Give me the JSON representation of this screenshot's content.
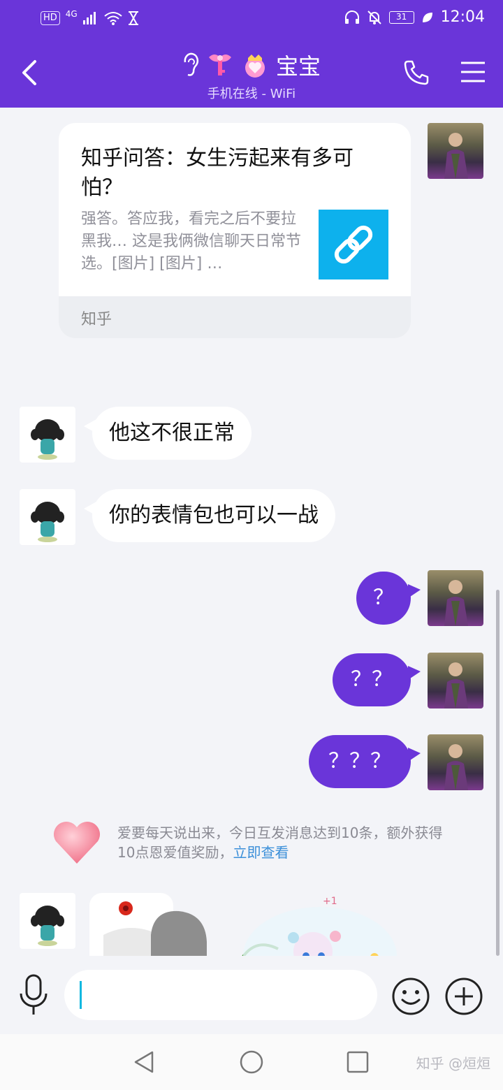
{
  "status_bar": {
    "left_icons": [
      "hd-icon",
      "4g-signal-icon",
      "wifi-icon",
      "hourglass-icon"
    ],
    "hd_label": "HD",
    "net_label": "4G",
    "battery": "31",
    "time": "12:04"
  },
  "header": {
    "title": "宝宝",
    "subtitle": "手机在线 - WiFi"
  },
  "link_card": {
    "title": "知乎问答：女生污起来有多可怕？",
    "description": "强答。答应我，看完之后不要拉黑我… 这是我俩微信聊天日常节选。[图片] [图片] …",
    "source": "知乎"
  },
  "messages": [
    {
      "direction": "in",
      "text": "他这不很正常"
    },
    {
      "direction": "in",
      "text": "你的表情包也可以一战"
    },
    {
      "direction": "out",
      "text": "？"
    },
    {
      "direction": "out",
      "text": "？？"
    },
    {
      "direction": "out",
      "text": "？？？"
    }
  ],
  "system_tip": {
    "text": "爱要每天说出来，今日互发消息达到10条，额外获得10点恩爱值奖励，",
    "link": "立即查看"
  },
  "input": {
    "value": "",
    "placeholder": ""
  },
  "watermark": "知乎 @烜烜",
  "colors": {
    "header": "#6a35d9",
    "outgoing_bubble": "#6a35d9",
    "link": "#3b8fd9",
    "link_thumb": "#0db1ed"
  }
}
